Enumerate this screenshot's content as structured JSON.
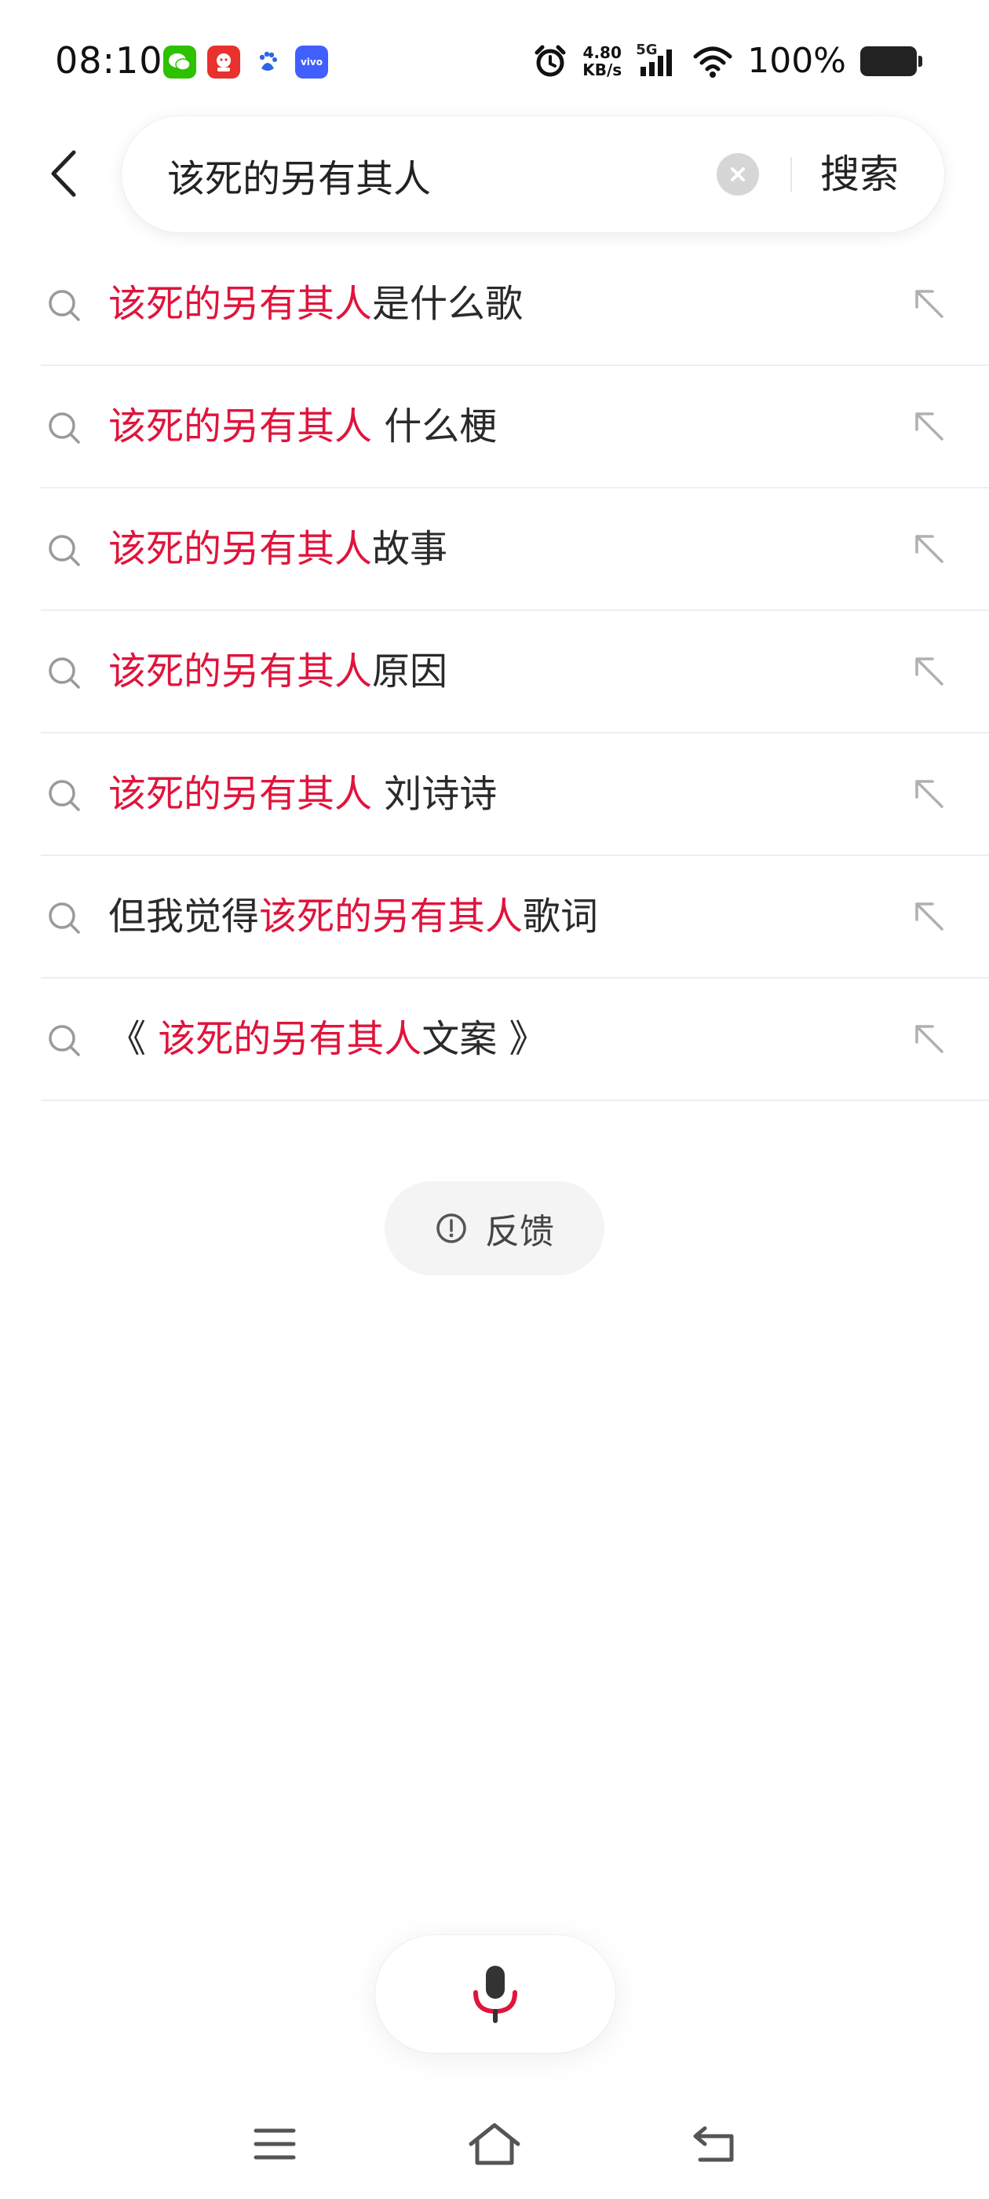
{
  "status_bar": {
    "time": "08:10",
    "apps": [
      {
        "icon": "wechat-icon",
        "color": "#2dc100"
      },
      {
        "icon": "red-app-icon",
        "color": "#e8322d"
      },
      {
        "icon": "baidu-icon",
        "color": "#2a67e8"
      },
      {
        "icon": "vivo-icon",
        "color": "#415fff",
        "label": "vivo"
      }
    ],
    "net_speed_value": "4.80",
    "net_speed_unit": "KB/s",
    "network": "5G",
    "battery": "100%"
  },
  "search": {
    "query": "该死的另有其人",
    "button_label": "搜索"
  },
  "suggestions": [
    {
      "pre": "",
      "hl": "该死的另有其人",
      "post": "是什么歌"
    },
    {
      "pre": "",
      "hl": "该死的另有其人",
      "post": " 什么梗"
    },
    {
      "pre": "",
      "hl": "该死的另有其人",
      "post": "故事"
    },
    {
      "pre": "",
      "hl": "该死的另有其人",
      "post": "原因"
    },
    {
      "pre": "",
      "hl": "该死的另有其人",
      "post": " 刘诗诗"
    },
    {
      "pre": "但我觉得",
      "hl": "该死的另有其人",
      "post": "歌词"
    },
    {
      "pre": "《 ",
      "hl": "该死的另有其人",
      "post": "文案 》"
    }
  ],
  "feedback": {
    "label": "反馈"
  },
  "colors": {
    "highlight": "#e0143c",
    "mic_accent": "#e0143c"
  }
}
